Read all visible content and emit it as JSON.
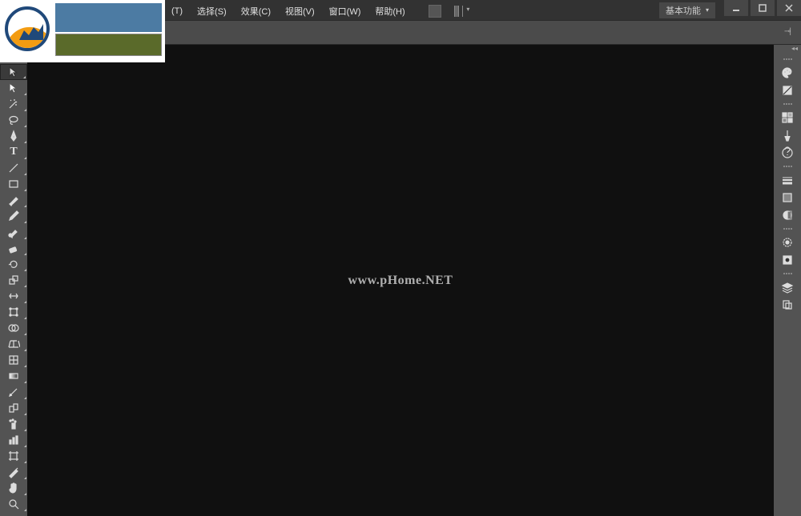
{
  "menus": {
    "type_t": "(T)",
    "select": "选择(S)",
    "effect": "效果(C)",
    "view": "视图(V)",
    "window": "窗口(W)",
    "help": "帮助(H)"
  },
  "workspace": {
    "label": "基本功能"
  },
  "watermark": "www.pHome.NET",
  "tools": [
    {
      "name": "selection-tool",
      "glyph": "cursor"
    },
    {
      "name": "direct-selection-tool",
      "glyph": "arrow"
    },
    {
      "name": "magic-wand-tool",
      "glyph": "wand"
    },
    {
      "name": "lasso-tool",
      "glyph": "lasso"
    },
    {
      "name": "pen-tool",
      "glyph": "pen"
    },
    {
      "name": "type-tool",
      "glyph": "T"
    },
    {
      "name": "line-segment-tool",
      "glyph": "line"
    },
    {
      "name": "rectangle-tool",
      "glyph": "rect"
    },
    {
      "name": "paintbrush-tool",
      "glyph": "brush"
    },
    {
      "name": "pencil-tool",
      "glyph": "pencil"
    },
    {
      "name": "blob-brush-tool",
      "glyph": "blob"
    },
    {
      "name": "eraser-tool",
      "glyph": "eraser"
    },
    {
      "name": "rotate-tool",
      "glyph": "rotate"
    },
    {
      "name": "scale-tool",
      "glyph": "scale"
    },
    {
      "name": "width-tool",
      "glyph": "width"
    },
    {
      "name": "free-transform-tool",
      "glyph": "transform"
    },
    {
      "name": "shape-builder-tool",
      "glyph": "builder"
    },
    {
      "name": "perspective-grid-tool",
      "glyph": "persp"
    },
    {
      "name": "mesh-tool",
      "glyph": "mesh"
    },
    {
      "name": "gradient-tool",
      "glyph": "grad"
    },
    {
      "name": "eyedropper-tool",
      "glyph": "eye"
    },
    {
      "name": "blend-tool",
      "glyph": "blend"
    },
    {
      "name": "symbol-sprayer-tool",
      "glyph": "spray"
    },
    {
      "name": "column-graph-tool",
      "glyph": "graph"
    },
    {
      "name": "artboard-tool",
      "glyph": "artboard"
    },
    {
      "name": "slice-tool",
      "glyph": "slice"
    },
    {
      "name": "hand-tool",
      "glyph": "hand"
    },
    {
      "name": "zoom-tool",
      "glyph": "zoom"
    }
  ],
  "right_panels": [
    {
      "name": "color-panel-icon",
      "glyph": "palette"
    },
    {
      "name": "color-guide-panel-icon",
      "glyph": "guide"
    },
    {
      "name": "swatches-panel-icon",
      "glyph": "swatch"
    },
    {
      "name": "brushes-panel-icon",
      "glyph": "brushes"
    },
    {
      "name": "symbols-panel-icon",
      "glyph": "symbol"
    },
    {
      "name": "stroke-panel-icon",
      "glyph": "stroke"
    },
    {
      "name": "gradient-panel-icon",
      "glyph": "grad2"
    },
    {
      "name": "transparency-panel-icon",
      "glyph": "trans"
    },
    {
      "name": "appearance-panel-icon",
      "glyph": "appear"
    },
    {
      "name": "graphic-styles-panel-icon",
      "glyph": "styles"
    },
    {
      "name": "layers-panel-icon",
      "glyph": "layers"
    },
    {
      "name": "artboards-panel-icon",
      "glyph": "artb"
    }
  ]
}
